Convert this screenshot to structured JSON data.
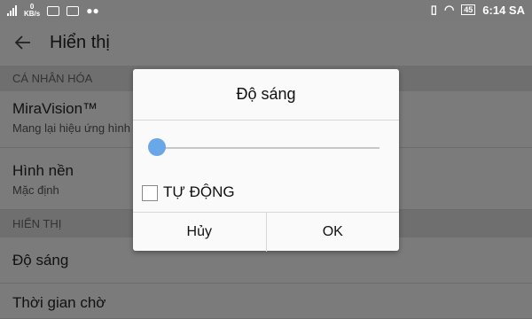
{
  "status": {
    "kbs": "0",
    "kbs_unit": "KB/s",
    "battery": "45",
    "time": "6:14 SA"
  },
  "appbar": {
    "title": "Hiển thị"
  },
  "sections": [
    {
      "label": "CÁ NHÂN HÓA"
    },
    {
      "label": "HIỂN THỊ"
    }
  ],
  "items": [
    {
      "title": "MiraVision™",
      "subtitle": "Mang lại hiệu ứng hình"
    },
    {
      "title": "Hình nền",
      "subtitle": "Mặc định"
    },
    {
      "title": "Độ sáng"
    },
    {
      "title": "Thời gian chờ"
    }
  ],
  "dialog": {
    "title": "Độ sáng",
    "brightness_level": 0.02,
    "auto_label": "TỰ ĐỘNG",
    "auto_checked": false,
    "cancel_label": "Hủy",
    "ok_label": "OK"
  },
  "colors": {
    "accent": "#6aa7e8",
    "scrim": "#7b7b7b",
    "dialog_bg": "#fafafa"
  }
}
